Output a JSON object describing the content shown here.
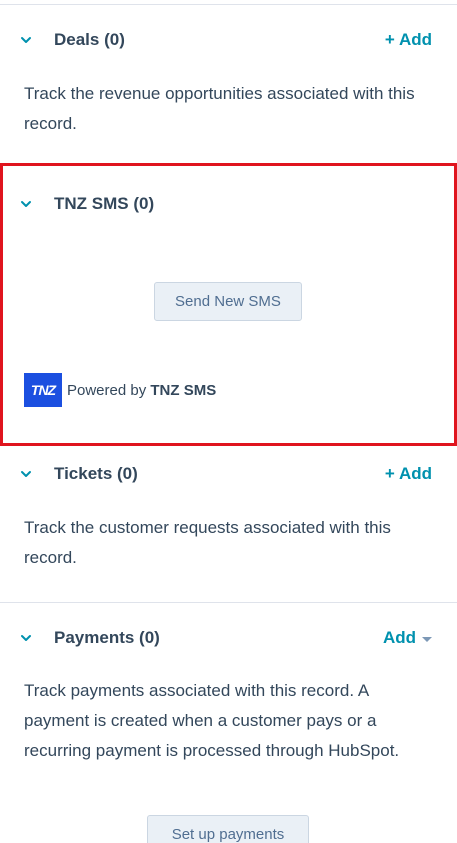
{
  "deals": {
    "title": "Deals (0)",
    "add_label": "+ Add",
    "description": "Track the revenue opportunities associated with this record."
  },
  "tnz": {
    "title": "TNZ SMS (0)",
    "send_button": "Send New SMS",
    "logo_text": "TNZ",
    "powered_by_prefix": "Powered by",
    "powered_by_brand": "TNZ SMS"
  },
  "tickets": {
    "title": "Tickets (0)",
    "add_label": "+ Add",
    "description": "Track the customer requests associated with this record."
  },
  "payments": {
    "title": "Payments (0)",
    "add_label": "Add",
    "description": "Track payments associated with this record. A payment is created when a customer pays or a recurring payment is processed through HubSpot.",
    "setup_button": "Set up payments"
  },
  "colors": {
    "accent": "#0091ae",
    "text": "#33475b",
    "highlight_border": "#e0141e",
    "tnz_blue": "#1b4fe0"
  }
}
